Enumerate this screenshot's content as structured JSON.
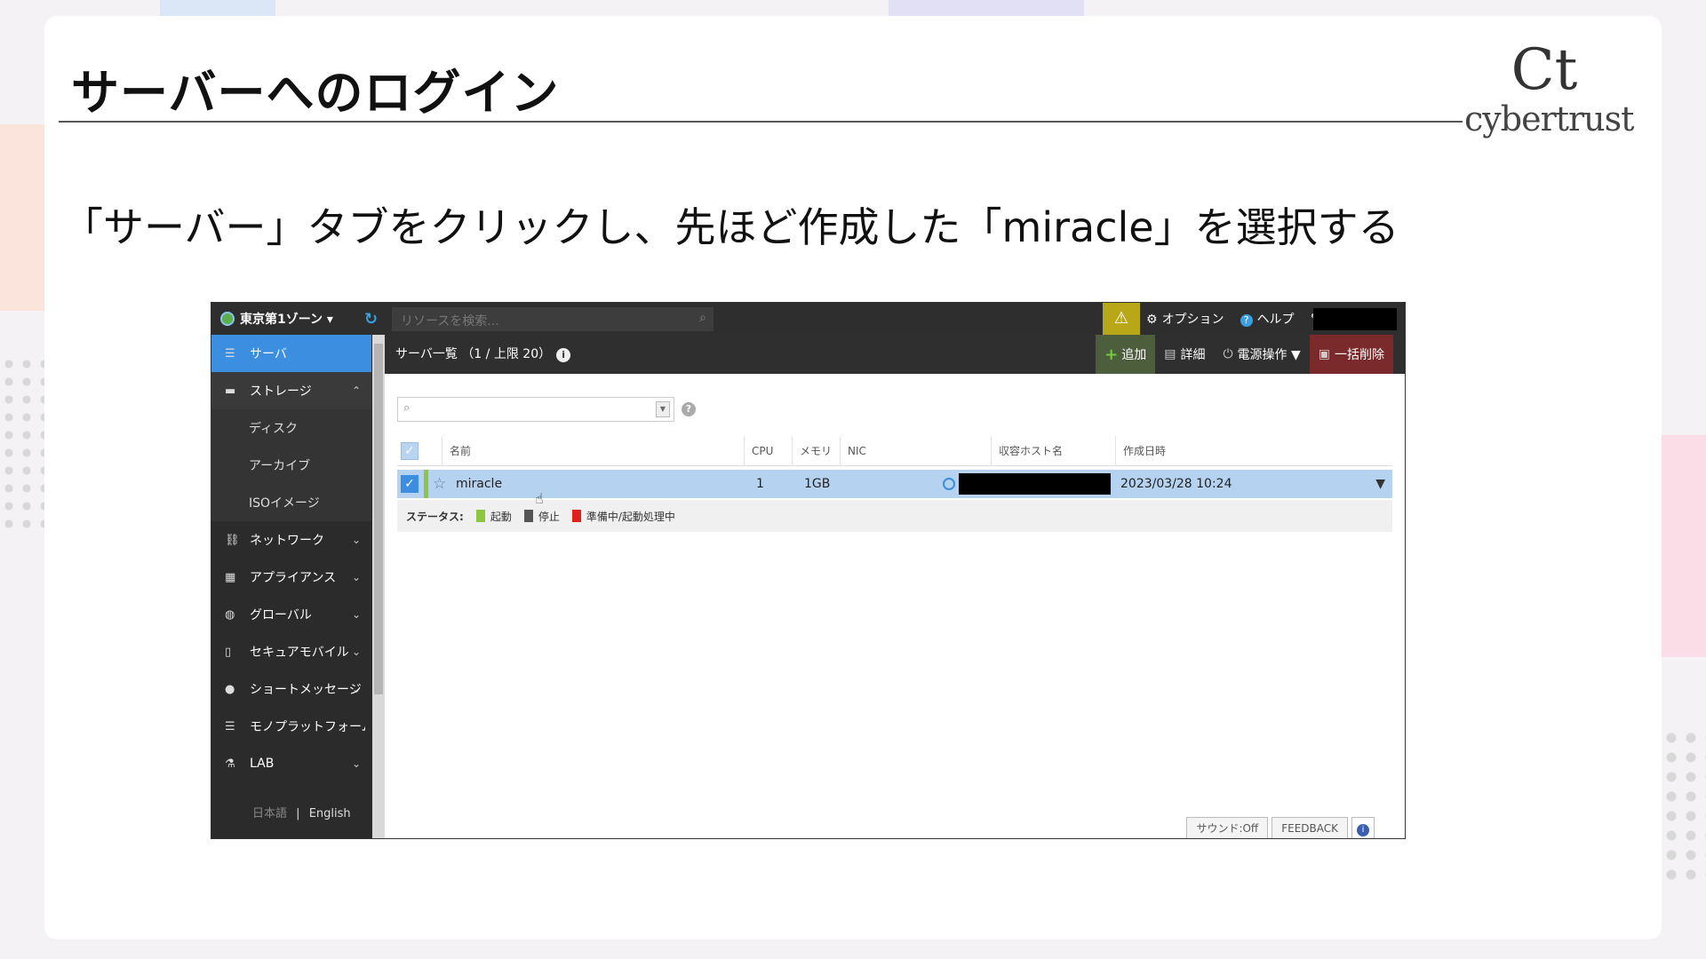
{
  "slide": {
    "title": "サーバーへのログイン",
    "instruction": "「サーバー」タブをクリックし、先ほど作成した「miracle」を選択する",
    "logo_text": "cybertrust",
    "logo_mark": "Ct"
  },
  "app": {
    "zone_label": "東京第1ゾーン ▾",
    "search_placeholder": "リソースを検索...",
    "top_menu": {
      "option": "オプション",
      "help": "ヘルプ"
    },
    "sidebar": {
      "items": [
        {
          "label": "サーバ"
        },
        {
          "label": "ストレージ"
        },
        {
          "label": "ネットワーク"
        },
        {
          "label": "アプライアンス"
        },
        {
          "label": "グローバル"
        },
        {
          "label": "セキュアモバイル"
        },
        {
          "label": "ショートメッセージ"
        },
        {
          "label": "モノプラットフォーム"
        },
        {
          "label": "LAB"
        }
      ],
      "storage_sub": [
        {
          "label": "ディスク"
        },
        {
          "label": "アーカイブ"
        },
        {
          "label": "ISOイメージ"
        }
      ],
      "lang_ja": "日本語",
      "lang_sep": "|",
      "lang_en": "English"
    },
    "panel": {
      "title": "サーバ一覧 （1 / 上限 20）",
      "actions": {
        "add": "追加",
        "detail": "詳細",
        "power": "電源操作 ▼",
        "bulk_delete": "一括削除"
      }
    },
    "table": {
      "headers": {
        "name": "名前",
        "cpu": "CPU",
        "memory": "メモリ",
        "nic": "NIC",
        "host": "収容ホスト名",
        "created": "作成日時"
      },
      "rows": [
        {
          "name": "miracle",
          "cpu": "1",
          "memory": "1GB",
          "created": "2023/03/28 10:24"
        }
      ]
    },
    "status_legend": {
      "label": "ステータス:",
      "running": "起動",
      "stopped": "停止",
      "preparing": "準備中/起動処理中"
    },
    "footer": {
      "sound": "サウンド:Off",
      "feedback": "FEEDBACK"
    }
  },
  "colors": {
    "accent_blue": "#3b8ee0",
    "status_running": "#8dc63f",
    "status_stopped": "#555555",
    "status_preparing": "#e0201a",
    "warn": "#b8a818"
  }
}
